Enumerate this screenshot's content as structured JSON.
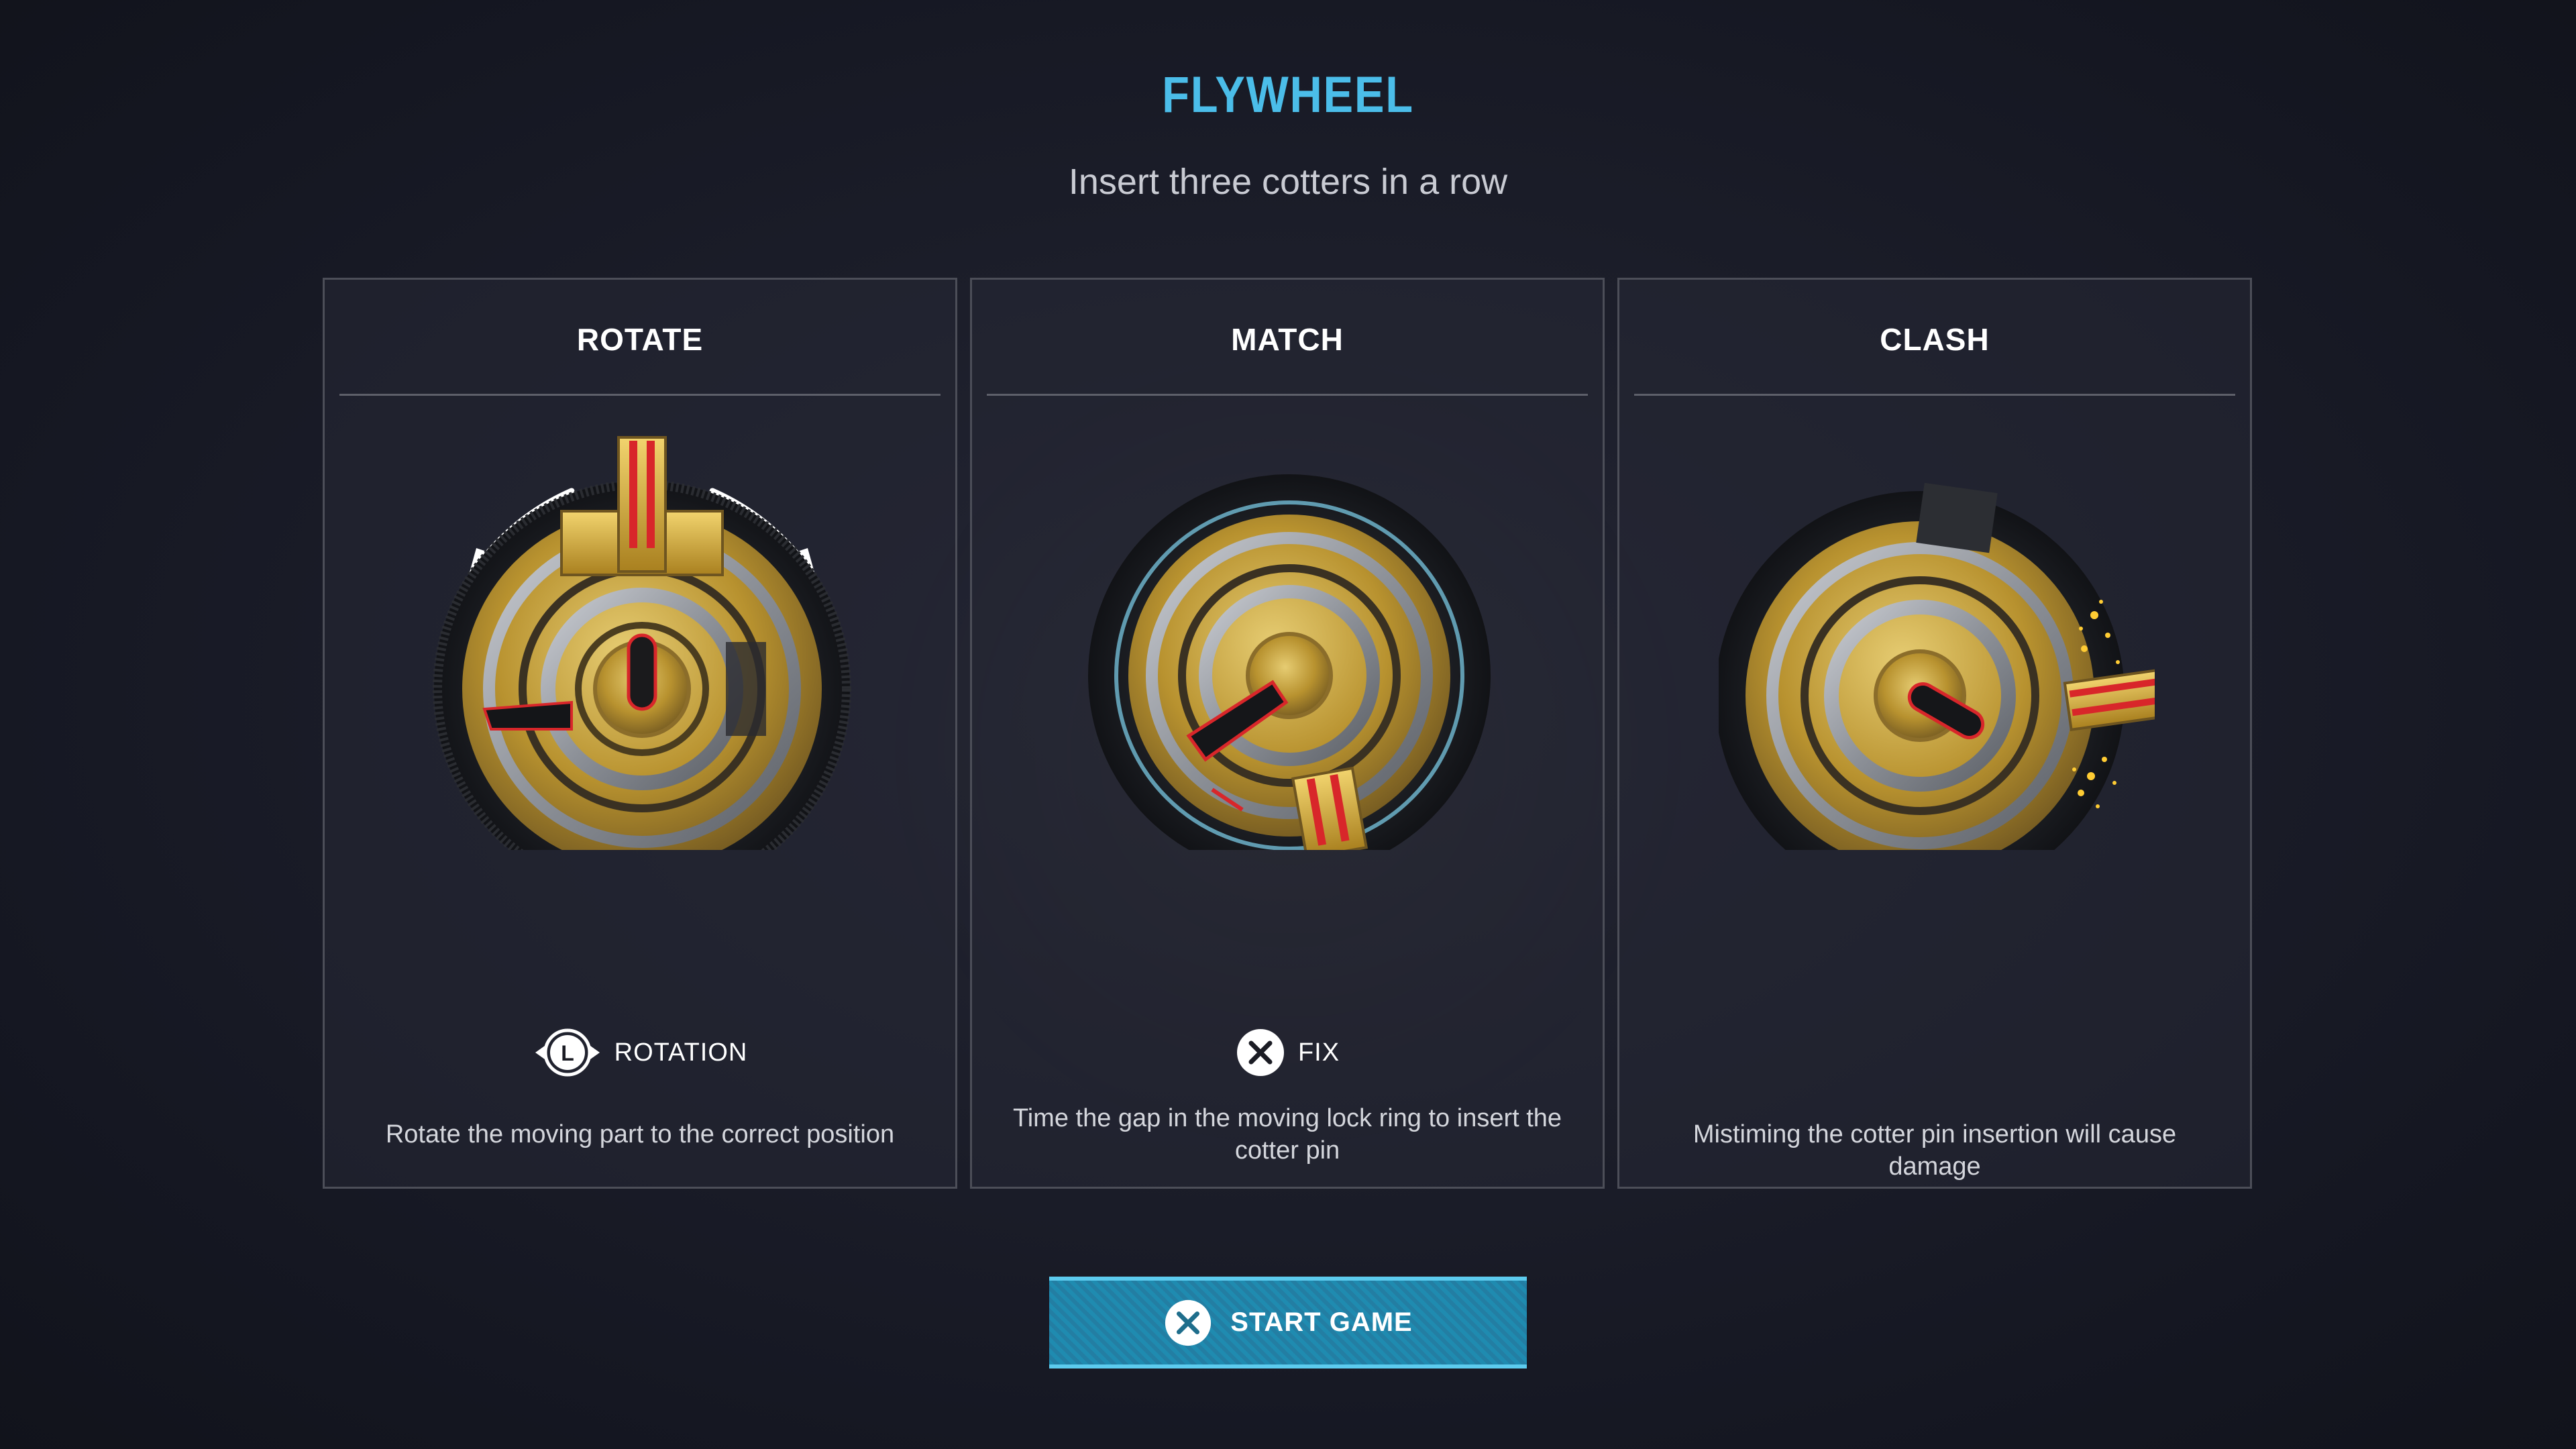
{
  "header": {
    "title": "FLYWHEEL",
    "subtitle": "Insert three cotters in a row"
  },
  "cards": [
    {
      "title": "ROTATE",
      "control": {
        "icon": "left-stick-icon",
        "glyph": "L",
        "label": "ROTATION"
      },
      "description": "Rotate the moving part to the correct position"
    },
    {
      "title": "MATCH",
      "control": {
        "icon": "cross-button-icon",
        "label": "FIX"
      },
      "description": "Time the gap in the moving lock ring to insert the cotter pin"
    },
    {
      "title": "CLASH",
      "description": "Mistiming the cotter pin insertion will cause damage"
    }
  ],
  "start_button": {
    "icon": "cross-button-icon",
    "label": "START GAME"
  },
  "colors": {
    "accent": "#4bbde9",
    "button": "#1f8bb0",
    "gold": "#c9a640",
    "warning_red": "#d8262a"
  }
}
